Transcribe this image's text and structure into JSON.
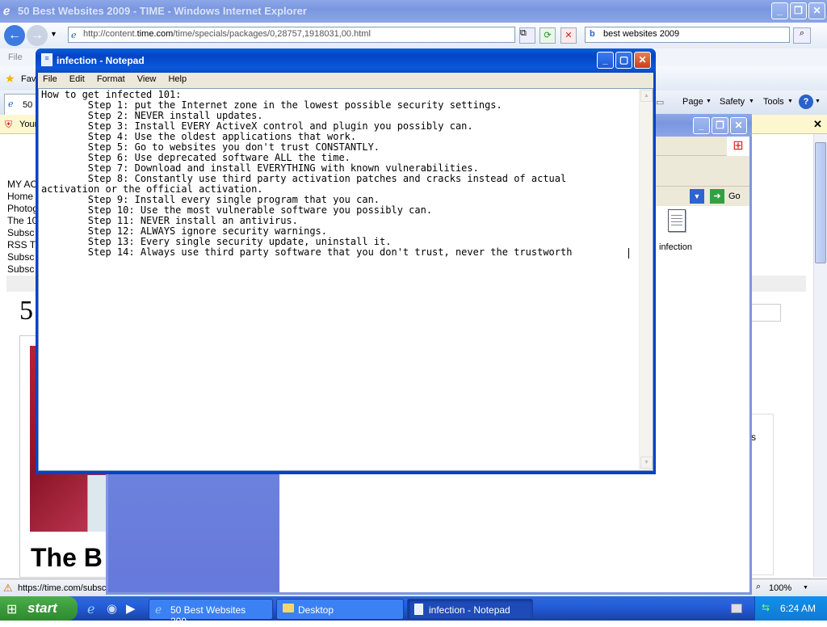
{
  "ie": {
    "title": "50 Best Websites 2009 - TIME - Windows Internet Explorer",
    "url_prefix": "http://content.",
    "url_domain": "time.com",
    "url_path": "/time/specials/packages/0,28757,1918031,00.html",
    "search_value": "best websites 2009",
    "menu_file": "File",
    "favorites": "Fav",
    "tab_label": "50",
    "cmd_page": "Page",
    "cmd_safety": "Safety",
    "cmd_tools": "Tools",
    "infobar_text": "Your",
    "sidebar_links": [
      "MY AC",
      "Home",
      "Photog",
      "The 10",
      "Subsc",
      "RSS T",
      "Subsc",
      "Subsc"
    ],
    "page_heading_char": "5",
    "page_big_text": "The B",
    "status_url": "https://time.com/subsc",
    "zoom": "100%",
    "stray_char": "s"
  },
  "explorer": {
    "go_label": "Go",
    "file_icon_label": "infection"
  },
  "notepad": {
    "title": "infection - Notepad",
    "menu": {
      "file": "File",
      "edit": "Edit",
      "format": "Format",
      "view": "View",
      "help": "Help"
    },
    "content": "How to get infected 101:\n        Step 1: put the Internet zone in the lowest possible security settings.\n        Step 2: NEVER install updates.\n        Step 3: Install EVERY ActiveX control and plugin you possibly can.\n        Step 4: Use the oldest applications that work.\n        Step 5: Go to websites you don't trust CONSTANTLY.\n        Step 6: Use deprecated software ALL the time.\n        Step 7: Download and install EVERYTHING with known vulnerabilities.\n        Step 8: Constantly use third party activation patches and cracks instead of actual\nactivation or the official activation.\n        Step 9: Install every single program that you can.\n        Step 10: Use the most vulnerable software you possibly can.\n        Step 11: NEVER install an antivirus.\n        Step 12: ALWAYS ignore security warnings.\n        Step 13: Every single security update, uninstall it.\n        Step 14: Always use third party software that you don't trust, never the trustworth"
  },
  "taskbar": {
    "start": "start",
    "items": [
      "50 Best Websites 200...",
      "Desktop",
      "infection - Notepad"
    ],
    "clock": "6:24 AM"
  },
  "colors": {
    "xp_blue": "#0a5fd8",
    "taskbar": "#245edb",
    "start_green": "#3c9a3c"
  }
}
